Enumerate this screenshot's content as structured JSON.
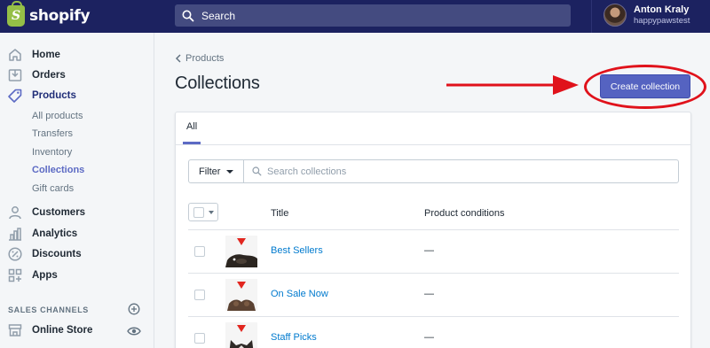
{
  "topbar": {
    "logo_text": "shopify",
    "logo_glyph": "S",
    "search_label": "Search",
    "user_name": "Anton Kraly",
    "store_name": "happypawstest"
  },
  "sidebar": {
    "items": [
      {
        "label": "Home",
        "icon": "home-icon"
      },
      {
        "label": "Orders",
        "icon": "orders-icon"
      },
      {
        "label": "Products",
        "icon": "tag-icon"
      },
      {
        "label": "Customers",
        "icon": "customers-icon"
      },
      {
        "label": "Analytics",
        "icon": "analytics-icon"
      },
      {
        "label": "Discounts",
        "icon": "discount-icon"
      },
      {
        "label": "Apps",
        "icon": "apps-icon"
      }
    ],
    "product_sub_items": [
      "All products",
      "Transfers",
      "Inventory",
      "Collections",
      "Gift cards"
    ],
    "sales_channels_title": "SALES CHANNELS",
    "online_store_label": "Online Store"
  },
  "main": {
    "breadcrumb": "Products",
    "page_title": "Collections",
    "create_button": "Create collection",
    "tab_all": "All",
    "filter_label": "Filter",
    "search_placeholder": "Search collections",
    "columns": {
      "title": "Title",
      "conditions": "Product conditions"
    },
    "rows": [
      {
        "title": "Best Sellers",
        "conditions": "—"
      },
      {
        "title": "On Sale Now",
        "conditions": "—"
      },
      {
        "title": "Staff Picks",
        "conditions": "—"
      }
    ]
  },
  "colors": {
    "topbar": "#1c2260",
    "accent": "#5c6ac4",
    "link": "#007ace",
    "annotation": "#e0121b"
  }
}
